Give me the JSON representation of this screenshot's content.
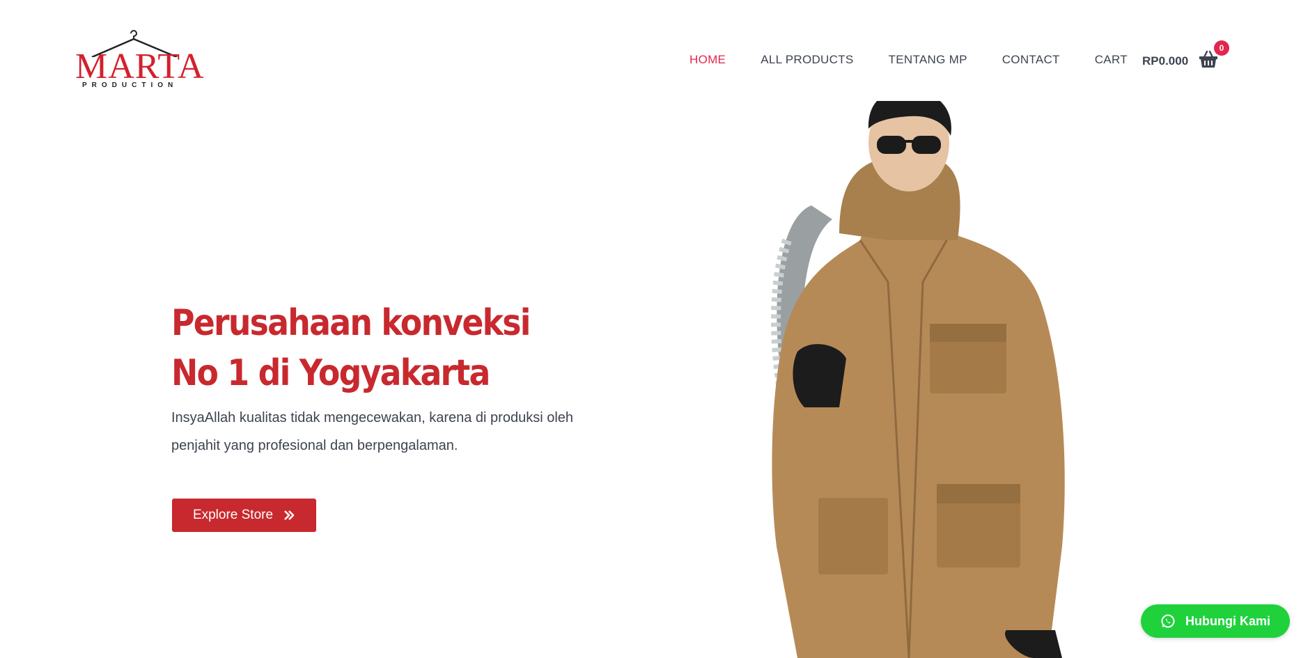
{
  "brand": {
    "name": "MARTA",
    "subtitle": "PRODUCTION",
    "color": "#d3212c"
  },
  "nav": {
    "items": [
      {
        "label": "HOME",
        "active": true
      },
      {
        "label": "ALL PRODUCTS",
        "active": false
      },
      {
        "label": "TENTANG MP",
        "active": false
      },
      {
        "label": "CONTACT",
        "active": false
      },
      {
        "label": "CART",
        "active": false
      }
    ],
    "active_color": "#e2264d"
  },
  "cart": {
    "total": "RP0.000",
    "count": "0",
    "icon": "basket-icon"
  },
  "hero": {
    "title": "Perusahaan konveksi No 1 di Yogyakarta",
    "description": "InsyaAllah kualitas tidak mengecewakan, karena di produksi oleh penjahit yang profesional dan berpengalaman.",
    "button_label": "Explore Store",
    "button_icon": "double-chevron-right-icon",
    "accent": "#c8292e",
    "image": "man-in-tan-jacket-photo"
  },
  "whatsapp": {
    "label": "Hubungi Kami",
    "icon": "whatsapp-icon",
    "color": "#1fd23c"
  }
}
